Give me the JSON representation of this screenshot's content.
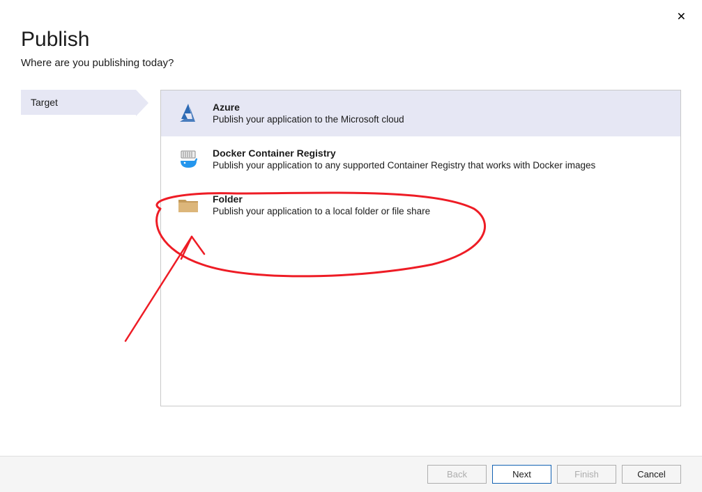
{
  "header": {
    "title": "Publish",
    "subtitle": "Where are you publishing today?"
  },
  "sidebar": {
    "items": [
      {
        "label": "Target"
      }
    ]
  },
  "options": [
    {
      "icon": "azure-icon",
      "title": "Azure",
      "description": "Publish your application to the Microsoft cloud"
    },
    {
      "icon": "docker-icon",
      "title": "Docker Container Registry",
      "description": "Publish your application to any supported Container Registry that works with Docker images"
    },
    {
      "icon": "folder-icon",
      "title": "Folder",
      "description": "Publish your application to a local folder or file share"
    }
  ],
  "footer": {
    "back": "Back",
    "next": "Next",
    "finish": "Finish",
    "cancel": "Cancel"
  },
  "annotation": {
    "stroke": "#ee1c25"
  }
}
